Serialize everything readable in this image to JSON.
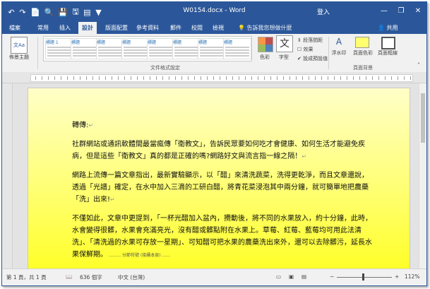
{
  "window": {
    "title": "W0154.docx - Word",
    "login": "登入",
    "minimize": "—",
    "restore": "❐",
    "close": "✕"
  },
  "qat": [
    "↶",
    "↷",
    "📄",
    "🔍",
    "💾",
    "🖫",
    "▤",
    "▼"
  ],
  "tabs": [
    {
      "label": "檔案",
      "active": false
    },
    {
      "label": "常用",
      "active": false
    },
    {
      "label": "插入",
      "active": false
    },
    {
      "label": "設計",
      "active": true
    },
    {
      "label": "版面配置",
      "active": false
    },
    {
      "label": "參考資料",
      "active": false
    },
    {
      "label": "郵件",
      "active": false
    },
    {
      "label": "校閱",
      "active": false
    },
    {
      "label": "檢視",
      "active": false
    }
  ],
  "tell_me": "告訴我您想做什麼",
  "share": "共用",
  "ribbon": {
    "theme_label": "佈景主題",
    "theme_thumb": "文Aa",
    "style_thumbs": [
      "標題 1",
      "標題",
      "標題",
      "標題",
      "標題",
      "標題",
      "標題",
      "標題"
    ],
    "colors_label": "色彩",
    "fonts_label": "字型",
    "paragraph_spacing": "段落間距",
    "effects": "效果",
    "set_default": "設成預設值",
    "watermark": "浮水印",
    "page_color": "頁面色彩",
    "page_borders": "頁面框線",
    "group_doc_format": "文件格式設定",
    "group_page_bg": "頁面背景"
  },
  "document": {
    "heading": "轉傳:",
    "paragraphs": [
      "社群網站或通訊軟體間最當瘋傳「衛教文」，告訴民眾要如何吃才會健康、如何生活才能避免疾病，但是這些「衛教文」真的都是正確的嗎?網路好文與流言指一線之隔！",
      "網路上流傳一篇文章指出，最新實驗顯示，以「醋」來清洗蔬菜，洗得更乾淨，而且文章還說，透過「光譜」確定，在水中加入三滴的工研白醋，將青花菜浸泡其中兩分鐘，就可簡單地把農藥「洗」出來!",
      "不僅如此，文章中更提到，「一杯光醋加入盆內，攪動後，將不同的水果放入，約十分鐘，此時，水會變得很髒，水果會充滿亮光，沒有醋或髒點附在水果上。草莓、紅莓、藍莓均可用此法清洗」、「清洗過的水果可存放一星期」、可知醋可把水果的農藥洗出來外，還可以去除髒污，延長水果保鮮期。"
    ],
    "page_break_label": "分節符號 (接續本頁)"
  },
  "status": {
    "page": "第 1 頁，共 1 頁",
    "words": "636 個字",
    "language": "中文 (台灣)",
    "zoom_minus": "−",
    "zoom_plus": "+",
    "zoom": "112%"
  }
}
